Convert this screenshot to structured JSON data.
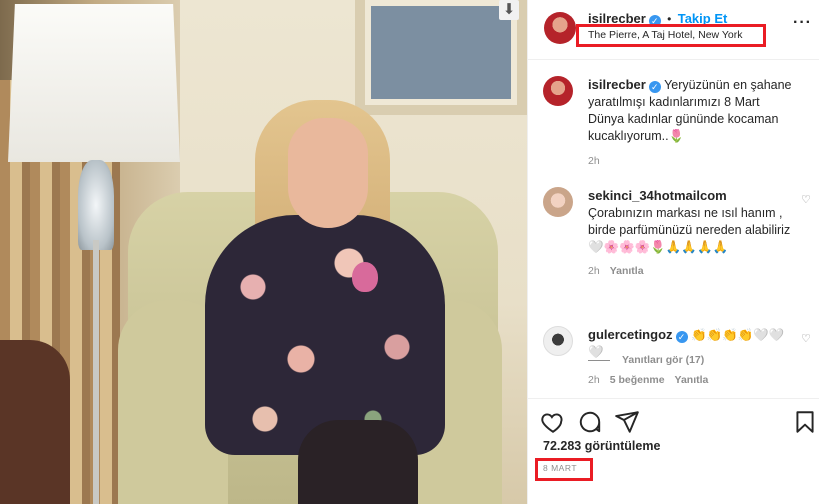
{
  "post": {
    "username": "isilrecber",
    "follow_label": "Takip Et",
    "separator": "•",
    "location": "The Pierre, A Taj Hotel, New York",
    "more_icon": "ellipsis-icon",
    "caption": "Yeryüzünün en şahane yaratılmışı kadınlarımızı 8 Mart Dünya kadınlar gününde kocaman kucaklıyorum..🌷",
    "caption_time": "2h"
  },
  "comments": [
    {
      "username": "sekinci_34hotmailcom",
      "text": "Çorabınızın markası ne ısıl hanım , birde parfümünüzü nereden alabiliriz 🤍🌸🌸🌸🌷🙏🙏🙏🙏",
      "time": "2h",
      "reply_label": "Yanıtla"
    },
    {
      "username": "gulercetingoz",
      "text": "👏👏👏👏🤍🤍🤍",
      "time": "2h",
      "likes_label": "5 beğenme",
      "reply_label": "Yanıtla"
    }
  ],
  "view_replies_label": "Yanıtları gör (17)",
  "actions": {
    "icons": [
      "heart-icon",
      "comment-icon",
      "share-icon",
      "bookmark-icon"
    ],
    "views_label": "72.283 görüntüleme",
    "date_label": "8 MART"
  },
  "colors": {
    "accent": "#0095f6",
    "verified": "#3897f0",
    "highlight_box": "#ea1c24",
    "muted_text": "#8e8e8e"
  }
}
